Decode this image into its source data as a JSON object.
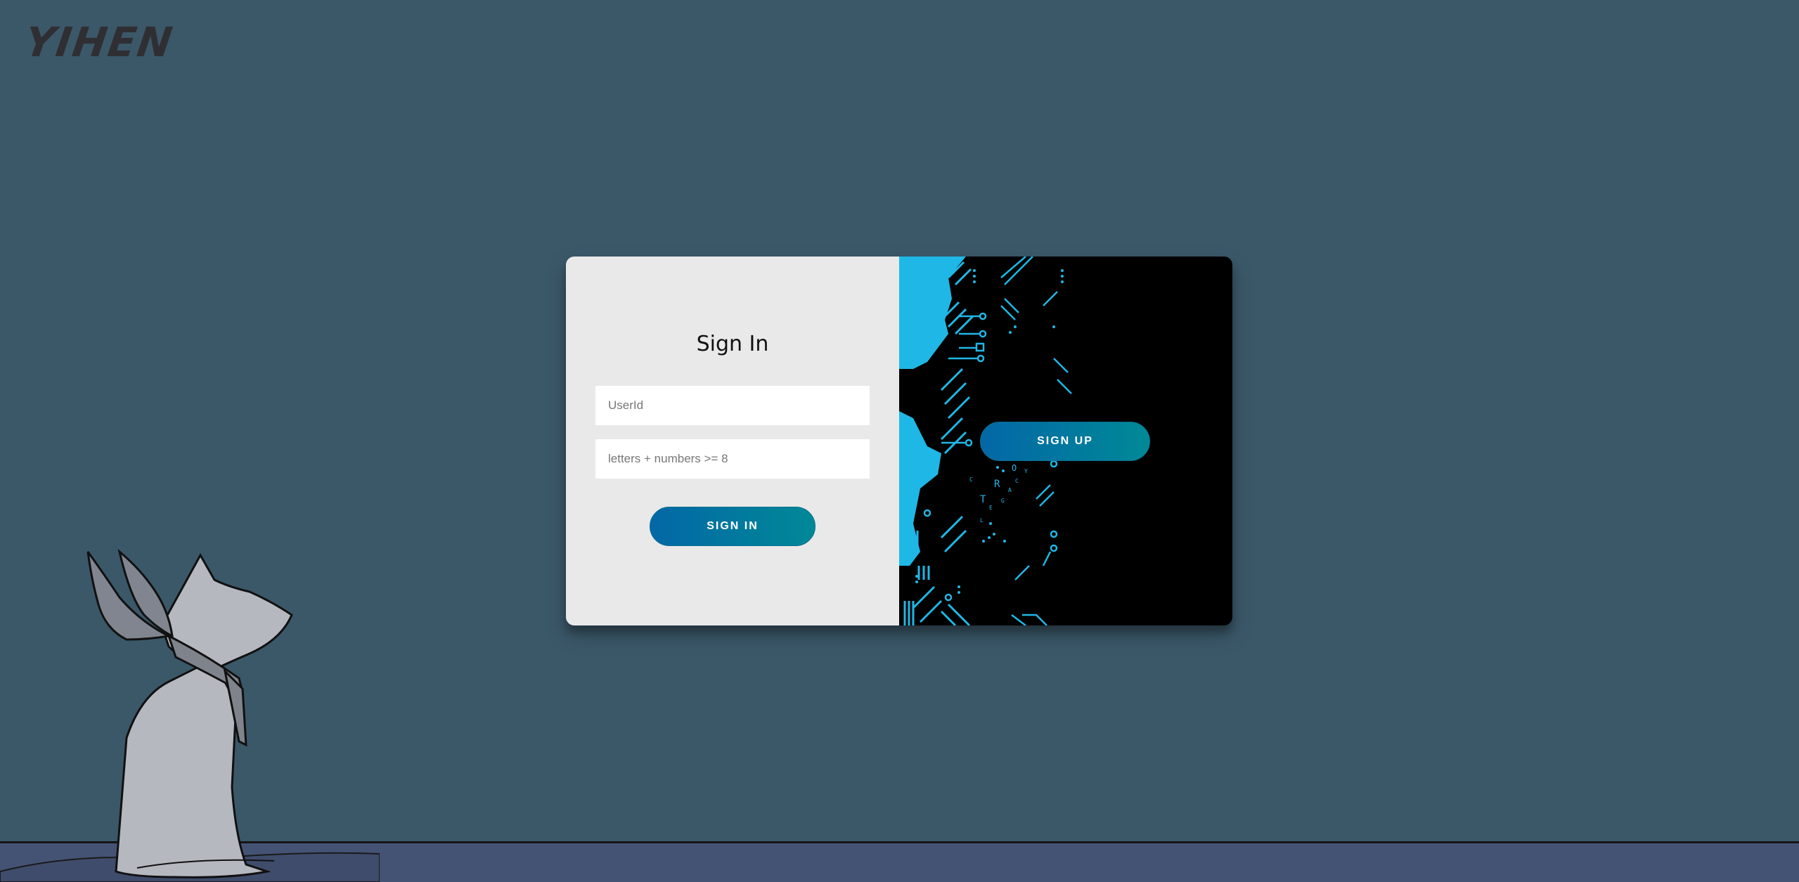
{
  "app": {
    "logo_text": "YIHEN"
  },
  "signin": {
    "title": "Sign In",
    "userid_placeholder": "UserId",
    "password_placeholder": "letters + numbers >= 8",
    "button_label": "SIGN IN"
  },
  "overlay": {
    "signup_label": "SIGN UP"
  },
  "colors": {
    "background": "#3b5869",
    "panel": "#e9e9e9",
    "button_gradient_start": "#0367a6",
    "button_gradient_end": "#008997",
    "circuit_accent": "#1fb8e6"
  },
  "icons": {
    "cat_illustration": "cat-illustration",
    "circuit_art": "circuit-board-art"
  }
}
